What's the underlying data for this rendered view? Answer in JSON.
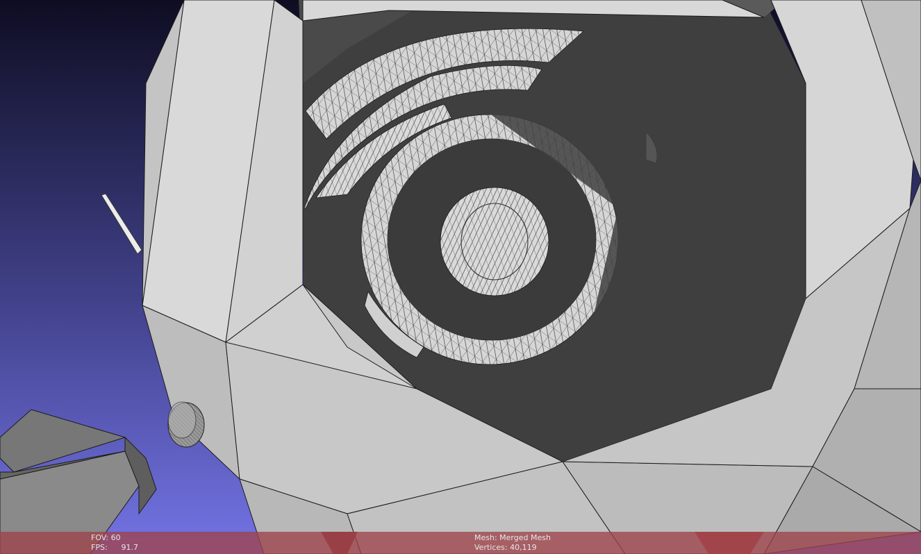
{
  "app": {
    "background_top": "#0e0d22",
    "background_bottom": "#7474e6",
    "status_bar_color": "#9e424a"
  },
  "overlay": {
    "fov_label": "FOV:",
    "fov_value": "60",
    "fps_label": "FPS:",
    "fps_value": "91.7",
    "mesh_label": "Mesh:",
    "mesh_value": "Merged Mesh",
    "vertices_label": "Vertices:",
    "vertices_value": "40,119"
  }
}
